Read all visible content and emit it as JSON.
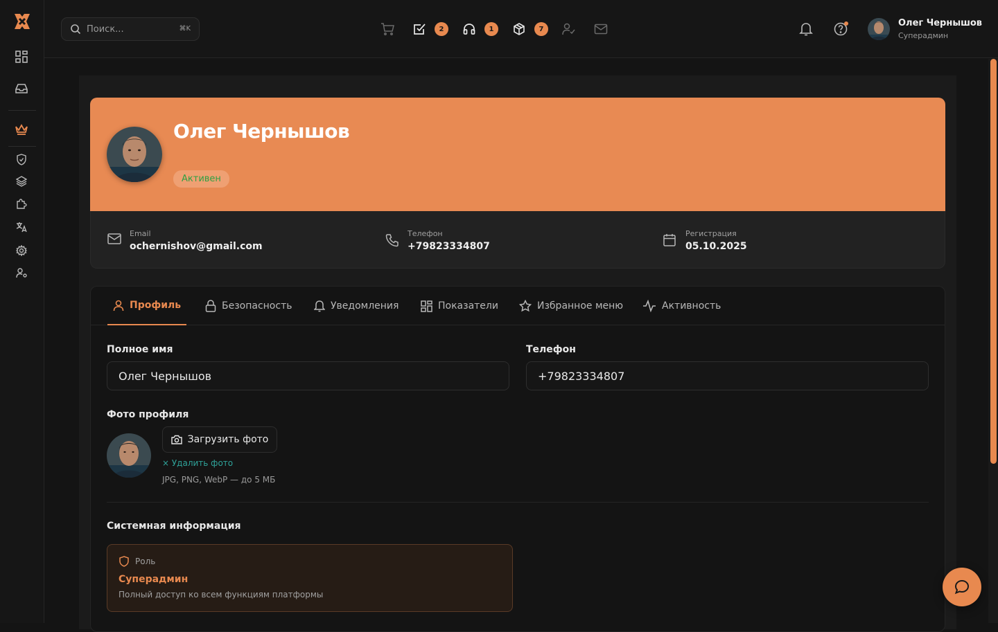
{
  "search": {
    "placeholder": "Поиск...",
    "shortcut": "⌘K"
  },
  "quick_badges": {
    "tasks": "2",
    "support": "1",
    "orders": "7"
  },
  "user": {
    "name": "Олег Чернышов",
    "role": "Суперадмин"
  },
  "profile": {
    "name": "Олег Чернышов",
    "status": "Активен",
    "email_label": "Email",
    "email": "ochernishov@gmail.com",
    "phone_label": "Телефон",
    "phone": "+79823334807",
    "reg_label": "Регистрация",
    "reg_date": "05.10.2025"
  },
  "tabs": [
    {
      "label": "Профиль"
    },
    {
      "label": "Безопасность"
    },
    {
      "label": "Уведомления"
    },
    {
      "label": "Показатели"
    },
    {
      "label": "Избранное меню"
    },
    {
      "label": "Активность"
    }
  ],
  "form": {
    "full_name_label": "Полное имя",
    "full_name_value": "Олег Чернышов",
    "phone_label": "Телефон",
    "phone_value": "+79823334807",
    "photo_label": "Фото профиля",
    "upload_label": "Загрузить фото",
    "delete_label": "× Удалить фото",
    "photo_hint": "JPG, PNG, WebP — до 5 МБ"
  },
  "system": {
    "title": "Системная информация",
    "role_label": "Роль",
    "role_value": "Суперадмин",
    "role_desc": "Полный доступ ко всем функциям платформы"
  },
  "colors": {
    "accent": "#e8894f",
    "background": "#141414",
    "status_green": "#2ea043"
  }
}
